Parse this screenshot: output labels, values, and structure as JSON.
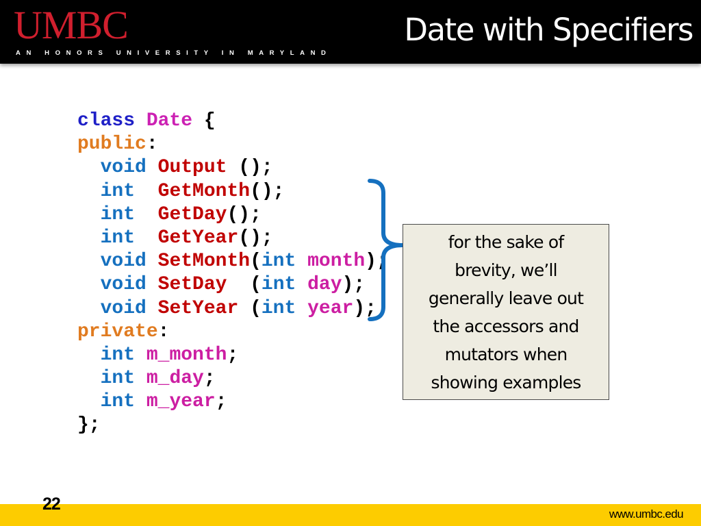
{
  "header": {
    "logo": "UMBC",
    "tagline": "AN HONORS UNIVERSITY IN MARYLAND",
    "title": "Date with Specifiers"
  },
  "colors": {
    "header_bg": "#000000",
    "logo": "#d11f2e",
    "footer_bg": "#fdcc00",
    "keyword_class": "#1f20c7",
    "class_name": "#cc21b3",
    "access_specifier": "#e07b20",
    "type": "#1570bf",
    "function_name": "#c00000",
    "variable": "#cc1ea2",
    "brace": "#1570bf",
    "callout_bg": "#eeece1"
  },
  "code": {
    "lines": [
      [
        {
          "t": "class",
          "c": "kw"
        },
        {
          "t": " ",
          "c": "punct"
        },
        {
          "t": "Date",
          "c": "cls"
        },
        {
          "t": " {",
          "c": "punct"
        }
      ],
      [
        {
          "t": "public",
          "c": "access"
        },
        {
          "t": ":",
          "c": "punct"
        }
      ],
      [
        {
          "t": "  ",
          "c": "punct"
        },
        {
          "t": "void",
          "c": "type"
        },
        {
          "t": " ",
          "c": "punct"
        },
        {
          "t": "Output",
          "c": "fn"
        },
        {
          "t": " ();",
          "c": "punct"
        }
      ],
      [
        {
          "t": "  ",
          "c": "punct"
        },
        {
          "t": "int",
          "c": "type"
        },
        {
          "t": "  ",
          "c": "punct"
        },
        {
          "t": "GetMonth",
          "c": "fn"
        },
        {
          "t": "();",
          "c": "punct"
        }
      ],
      [
        {
          "t": "  ",
          "c": "punct"
        },
        {
          "t": "int",
          "c": "type"
        },
        {
          "t": "  ",
          "c": "punct"
        },
        {
          "t": "GetDay",
          "c": "fn"
        },
        {
          "t": "();",
          "c": "punct"
        }
      ],
      [
        {
          "t": "  ",
          "c": "punct"
        },
        {
          "t": "int",
          "c": "type"
        },
        {
          "t": "  ",
          "c": "punct"
        },
        {
          "t": "GetYear",
          "c": "fn"
        },
        {
          "t": "();",
          "c": "punct"
        }
      ],
      [
        {
          "t": "  ",
          "c": "punct"
        },
        {
          "t": "void",
          "c": "type"
        },
        {
          "t": " ",
          "c": "punct"
        },
        {
          "t": "SetMonth",
          "c": "fn"
        },
        {
          "t": "(",
          "c": "punct"
        },
        {
          "t": "int",
          "c": "type"
        },
        {
          "t": " ",
          "c": "punct"
        },
        {
          "t": "month",
          "c": "var"
        },
        {
          "t": ");",
          "c": "punct"
        }
      ],
      [
        {
          "t": "  ",
          "c": "punct"
        },
        {
          "t": "void",
          "c": "type"
        },
        {
          "t": " ",
          "c": "punct"
        },
        {
          "t": "SetDay",
          "c": "fn"
        },
        {
          "t": "  (",
          "c": "punct"
        },
        {
          "t": "int",
          "c": "type"
        },
        {
          "t": " ",
          "c": "punct"
        },
        {
          "t": "day",
          "c": "var"
        },
        {
          "t": ");",
          "c": "punct"
        }
      ],
      [
        {
          "t": "  ",
          "c": "punct"
        },
        {
          "t": "void",
          "c": "type"
        },
        {
          "t": " ",
          "c": "punct"
        },
        {
          "t": "SetYear",
          "c": "fn"
        },
        {
          "t": " (",
          "c": "punct"
        },
        {
          "t": "int",
          "c": "type"
        },
        {
          "t": " ",
          "c": "punct"
        },
        {
          "t": "year",
          "c": "var"
        },
        {
          "t": ");",
          "c": "punct"
        }
      ],
      [
        {
          "t": "private",
          "c": "access"
        },
        {
          "t": ":",
          "c": "punct"
        }
      ],
      [
        {
          "t": "  ",
          "c": "punct"
        },
        {
          "t": "int",
          "c": "type"
        },
        {
          "t": " ",
          "c": "punct"
        },
        {
          "t": "m_month",
          "c": "var"
        },
        {
          "t": ";",
          "c": "punct"
        }
      ],
      [
        {
          "t": "  ",
          "c": "punct"
        },
        {
          "t": "int",
          "c": "type"
        },
        {
          "t": " ",
          "c": "punct"
        },
        {
          "t": "m_day",
          "c": "var"
        },
        {
          "t": ";",
          "c": "punct"
        }
      ],
      [
        {
          "t": "  ",
          "c": "punct"
        },
        {
          "t": "int",
          "c": "type"
        },
        {
          "t": " ",
          "c": "punct"
        },
        {
          "t": "m_year",
          "c": "var"
        },
        {
          "t": ";",
          "c": "punct"
        }
      ],
      [
        {
          "t": "};",
          "c": "punct"
        }
      ]
    ]
  },
  "callout": {
    "lines": [
      "for the sake of",
      "brevity, we’ll",
      "generally leave out",
      "the accessors and",
      "mutators when",
      "showing examples"
    ]
  },
  "footer": {
    "page_number": "22",
    "url": "www.umbc.edu"
  }
}
